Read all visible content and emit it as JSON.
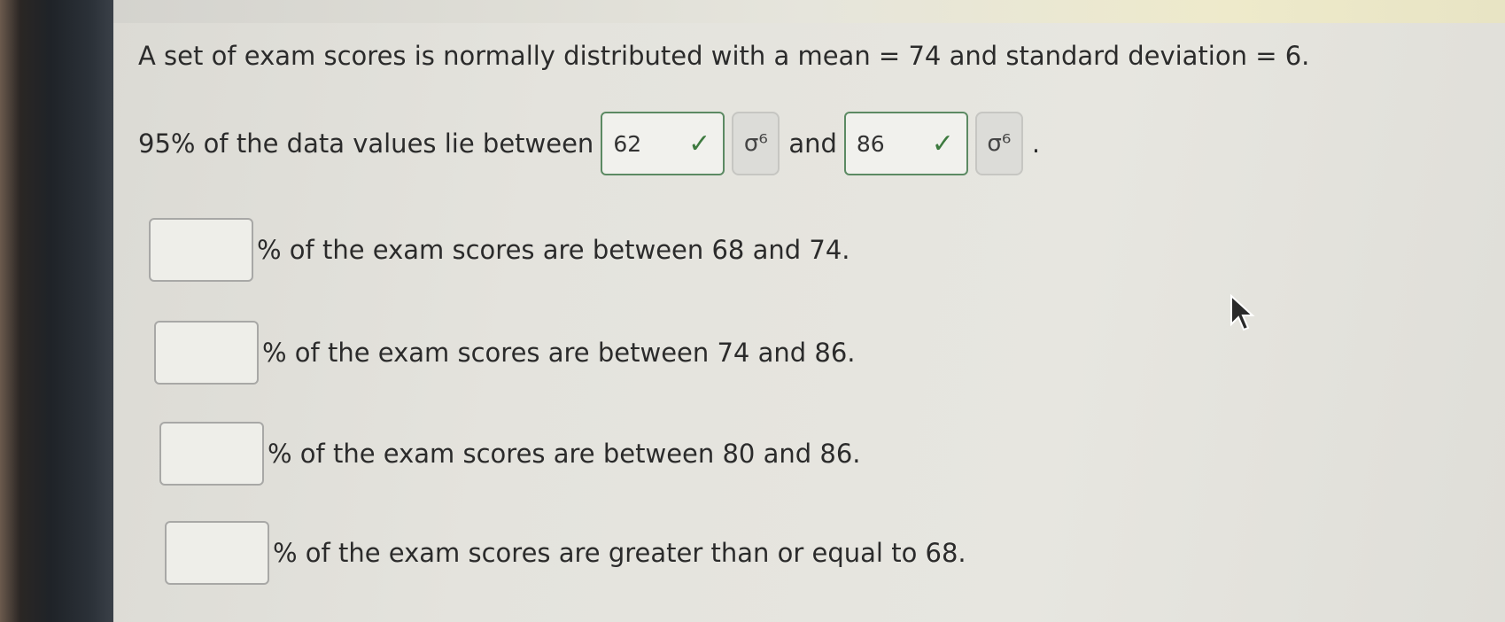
{
  "question": {
    "prompt": "A set of exam scores is normally distributed with a mean = 74 and standard deviation = 6."
  },
  "answered_row": {
    "lead_text": "95% of the data values lie between",
    "first_value": "62",
    "middle_text": "and",
    "second_value": "86",
    "end_text": ".",
    "check_glyph": "✓",
    "sigma_glyph": "σ⁶"
  },
  "blank_rows": [
    {
      "text": "% of the exam scores are between 68 and 74."
    },
    {
      "text": "% of the exam scores are between 74 and 86."
    },
    {
      "text": "% of the exam scores are between 80 and 86."
    },
    {
      "text": "% of the exam scores are greater than or equal to 68."
    }
  ],
  "colors": {
    "correct_border": "#5c8a63",
    "check_mark": "#3d7a3f",
    "text": "#2b2b2b"
  }
}
